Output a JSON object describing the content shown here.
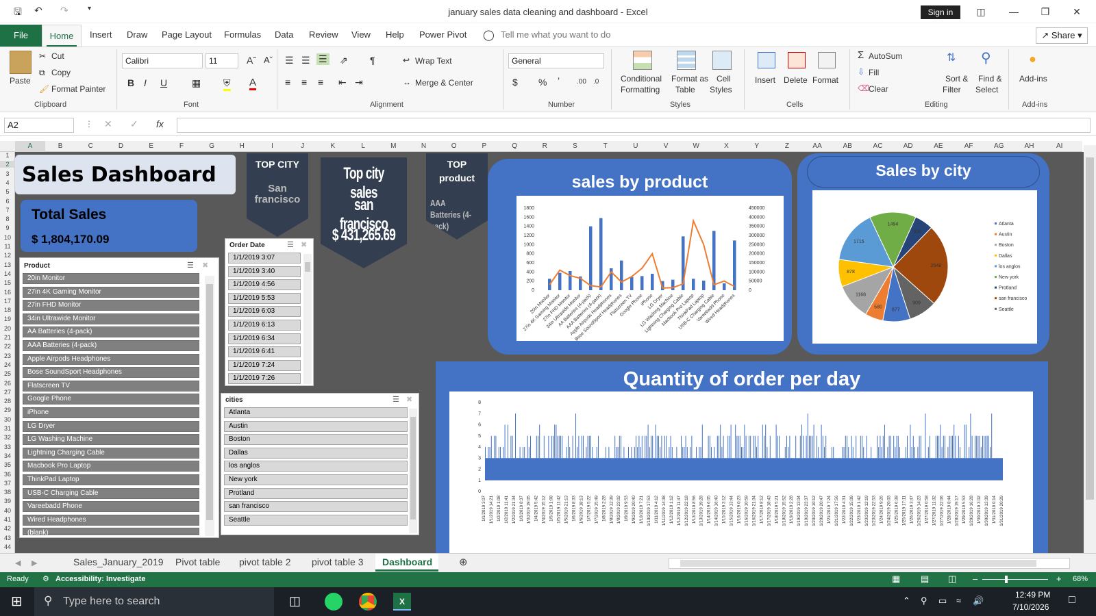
{
  "window": {
    "title": "january sales data cleaning and dashboard  -  Excel",
    "signin": "Sign in"
  },
  "menu": {
    "file": "File",
    "tabs": [
      "Home",
      "Insert",
      "Draw",
      "Page Layout",
      "Formulas",
      "Data",
      "Review",
      "View",
      "Help",
      "Power Pivot"
    ],
    "tell_me": "Tell me what you want to do",
    "share": "Share"
  },
  "ribbon": {
    "clipboard": {
      "paste": "Paste",
      "cut": "Cut",
      "copy": "Copy",
      "format_painter": "Format Painter",
      "label": "Clipboard"
    },
    "font": {
      "name": "Calibri",
      "size": "11",
      "label": "Font"
    },
    "alignment": {
      "wrap": "Wrap Text",
      "merge": "Merge & Center",
      "label": "Alignment"
    },
    "number": {
      "format": "General",
      "label": "Number"
    },
    "styles": {
      "conditional": "Conditional",
      "formatting": "Formatting",
      "format_as": "Format as",
      "table": "Table",
      "cell": "Cell",
      "styles_word": "Styles",
      "label": "Styles"
    },
    "cells": {
      "insert": "Insert",
      "delete": "Delete",
      "format": "Format",
      "label": "Cells"
    },
    "editing": {
      "autosum": "AutoSum",
      "fill": "Fill",
      "clear": "Clear",
      "sort": "Sort &",
      "filter": "Filter",
      "find": "Find &",
      "select": "Select",
      "label": "Editing"
    },
    "addins": {
      "addins": "Add-ins",
      "label": "Add-ins"
    }
  },
  "formula_bar": {
    "namebox": "A2",
    "fx": "fx",
    "value": ""
  },
  "columns": [
    "A",
    "B",
    "C",
    "D",
    "E",
    "F",
    "G",
    "H",
    "I",
    "J",
    "K",
    "L",
    "M",
    "N",
    "O",
    "P",
    "Q",
    "R",
    "S",
    "T",
    "U",
    "V",
    "W",
    "X",
    "Y",
    "Z",
    "AA",
    "AB",
    "AC",
    "AD",
    "AE",
    "AF",
    "AG",
    "AH",
    "AI"
  ],
  "rows": [
    "1",
    "2",
    "3",
    "4",
    "5",
    "6",
    "7",
    "8",
    "9",
    "10",
    "11",
    "12",
    "13",
    "14",
    "15",
    "16",
    "17",
    "18",
    "19",
    "20",
    "21",
    "22",
    "23",
    "24",
    "25",
    "26",
    "27",
    "28",
    "29",
    "30",
    "31",
    "32",
    "33",
    "34",
    "35",
    "36",
    "37",
    "38",
    "39",
    "40",
    "41",
    "42",
    "43",
    "44"
  ],
  "dashboard": {
    "title": "Sales Dashboard",
    "total_label": "Total Sales",
    "total_value": "$ 1,804,170.09",
    "top_city_label": "TOP CITY",
    "top_city_value": "San francisco",
    "top_city_sales_label": "Top city sales",
    "top_city_sales_city": "san francisco",
    "top_city_sales_value": "$ 431,265.69",
    "top_product_label": "TOP product",
    "top_product_value": "AAA Batteries (4-pack)"
  },
  "slicers": {
    "product": {
      "title": "Product",
      "items": [
        "20in Monitor",
        "27in 4K Gaming Monitor",
        "27in FHD Monitor",
        "34in Ultrawide Monitor",
        "AA Batteries (4-pack)",
        "AAA Batteries (4-pack)",
        "Apple Airpods Headphones",
        "Bose SoundSport Headphones",
        "Flatscreen TV",
        "Google Phone",
        "iPhone",
        "LG Dryer",
        "LG Washing Machine",
        "Lightning Charging Cable",
        "Macbook Pro Laptop",
        "ThinkPad Laptop",
        "USB-C Charging Cable",
        "Vareebadd Phone",
        "Wired Headphones",
        "(blank)"
      ]
    },
    "order_date": {
      "title": "Order Date",
      "items": [
        "1/1/2019 3:07",
        "1/1/2019 3:40",
        "1/1/2019 4:56",
        "1/1/2019 5:53",
        "1/1/2019 6:03",
        "1/1/2019 6:13",
        "1/1/2019 6:34",
        "1/1/2019 6:41",
        "1/1/2019 7:24",
        "1/1/2019 7:26"
      ]
    },
    "cities": {
      "title": "cities",
      "items": [
        "Atlanta",
        "Austin",
        "Boston",
        "Dallas",
        "los anglos",
        "New york",
        "Protland",
        "san francisco",
        "Seattle"
      ]
    }
  },
  "chart_data": [
    {
      "type": "bar",
      "title": "sales by product",
      "categories": [
        "20in Monitor",
        "27in 4K Gaming Monitor",
        "27in FHD Monitor",
        "34in Ultrawide Monitor",
        "AA Batteries (4-pack)",
        "AAA Batteries (4-pack)",
        "Apple Airpods Headphones",
        "Bose SoundSport Headphones",
        "Flatscreen TV",
        "Google Phone",
        "iPhone",
        "LG Dryer",
        "LG Washing Machine",
        "Lightning Charging Cable",
        "Macbook Pro Laptop",
        "ThinkPad Laptop",
        "USB-C Charging Cable",
        "Vareebadd Phone",
        "Wired Headphones"
      ],
      "series": [
        {
          "axis": "left",
          "values": [
            250,
            380,
            420,
            300,
            1400,
            1580,
            480,
            650,
            290,
            310,
            360,
            200,
            230,
            1180,
            250,
            210,
            1300,
            150,
            1090
          ]
        },
        {
          "axis": "right",
          "values": [
            30000,
            110000,
            80000,
            65000,
            25000,
            18000,
            100000,
            45000,
            75000,
            120000,
            200000,
            12000,
            14000,
            35000,
            380000,
            250000,
            30000,
            50000,
            20000
          ]
        }
      ],
      "y_left_ticks": [
        0,
        200,
        400,
        600,
        800,
        1000,
        1200,
        1400,
        1600,
        1800
      ],
      "y_right_ticks": [
        0,
        50000,
        100000,
        150000,
        200000,
        250000,
        300000,
        350000,
        400000,
        450000
      ]
    },
    {
      "type": "pie",
      "title": "Sales by city",
      "categories": [
        "Atlanta",
        "Austin",
        "Boston",
        "Dallas",
        "los anglos",
        "New york",
        "Protland",
        "san francisco",
        "Seattle"
      ],
      "values": [
        1494,
        600,
        2648,
        909,
        877,
        580,
        1168,
        878,
        1715
      ],
      "colors": [
        "#70ad47",
        "#264478",
        "#9e480e",
        "#636363",
        "#4472c4",
        "#ed7d31",
        "#a5a5a5",
        "#ffc000",
        "#5b9bd5"
      ],
      "legend": [
        "Atlanta",
        "Austin",
        "Boston",
        "Dallas",
        "los anglos",
        "New york",
        "Protland",
        "san francisco",
        "Seattle"
      ],
      "legend_colors": [
        "#4472c4",
        "#ed7d31",
        "#a5a5a5",
        "#ffc000",
        "#5b9bd5",
        "#70ad47",
        "#264478",
        "#9e480e",
        "#636363"
      ]
    },
    {
      "type": "bar",
      "title": "Quantity of order per day",
      "y_ticks": [
        0,
        1,
        2,
        3,
        4,
        5,
        6,
        7,
        8
      ],
      "ylim": [
        0,
        8
      ],
      "x_labels": [
        "1/1/2019 3:07",
        "1/1/2019 14:21",
        "1/2/2019 1:08",
        "1/2/2019 11:41",
        "1/2/2019 21:34",
        "1/3/2019 8:37",
        "1/3/2019 19:05",
        "1/4/2019 5:42",
        "1/4/2019 15:12",
        "1/5/2019 1:08",
        "1/5/2019 11:42",
        "1/5/2019 21:13",
        "1/6/2019 8:33",
        "1/6/2019 18:13",
        "1/7/2019 5:22",
        "1/7/2019 15:49",
        "1/8/2019 2:28",
        "1/8/2019 12:39",
        "1/8/2019 23:02",
        "1/9/2019 9:53",
        "1/9/2019 20:40",
        "1/10/2019 7:21",
        "1/10/2019 17:53",
        "1/11/2019 4:12",
        "1/11/2019 14:38",
        "1/12/2019 1:12",
        "1/12/2019 11:47",
        "1/12/2019 22:18",
        "1/13/2019 8:56",
        "1/13/2019 19:28",
        "1/14/2019 6:05",
        "1/14/2019 16:40",
        "1/15/2019 3:12",
        "1/15/2019 13:44",
        "1/16/2019 0:23",
        "1/16/2019 10:59",
        "1/16/2019 21:34",
        "1/17/2019 8:12",
        "1/17/2019 18:43",
        "1/18/2019 5:21",
        "1/18/2019 15:52",
        "1/19/2019 2:28",
        "1/19/2019 13:04",
        "1/19/2019 23:37",
        "1/20/2019 10:12",
        "1/20/2019 20:47",
        "1/21/2019 7:24",
        "1/21/2019 17:56",
        "1/22/2019 4:31",
        "1/22/2019 15:09",
        "1/23/2019 1:42",
        "1/23/2019 12:19",
        "1/23/2019 22:53",
        "1/24/2019 9:26",
        "1/24/2019 20:03",
        "1/25/2019 6:38",
        "1/25/2019 17:11",
        "1/26/2019 3:47",
        "1/26/2019 14:23",
        "1/27/2019 0:58",
        "1/27/2019 11:32",
        "1/27/2019 22:06",
        "1/28/2019 8:44",
        "1/28/2019 19:17",
        "1/29/2019 5:53",
        "1/29/2019 16:28",
        "1/30/2019 3:02",
        "1/30/2019 13:39",
        "1/31/2019 0:14",
        "1/31/2019 20:29"
      ]
    }
  ],
  "sheet_tabs": [
    "Sales_January_2019",
    "Pivot table",
    "pivot table 2",
    "pivot table 3",
    "Dashboard"
  ],
  "status": {
    "ready": "Ready",
    "accessibility": "Accessibility: Investigate",
    "zoom": "68%"
  },
  "taskbar": {
    "search": "Type here to search",
    "time": "12:49 PM",
    "date": "7/10/2026"
  }
}
